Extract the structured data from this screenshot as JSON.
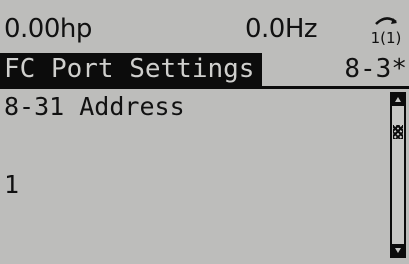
{
  "status": {
    "power": "0.00hp",
    "frequency": "0.0Hz",
    "setup_indicator": "1(1)"
  },
  "header": {
    "title": "FC Port Settings",
    "group_number": "8-3*"
  },
  "parameter": {
    "name": "8-31 Address",
    "value": "1"
  },
  "scrollbar": {
    "position": 0.15
  },
  "colors": {
    "lcd_background": "#bdbdbb",
    "lcd_foreground": "#0c0c0c"
  }
}
